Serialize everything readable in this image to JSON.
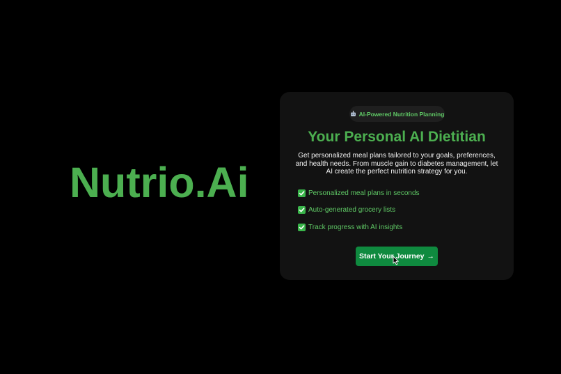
{
  "brand": {
    "name": "Nutrio.Ai",
    "color": "#4caf50"
  },
  "card": {
    "badge": {
      "icon": "robot-icon",
      "label": "AI-Powered Nutrition Planning"
    },
    "title": "Your Personal AI Dietitian",
    "description": "Get personalized meal plans tailored to your goals, preferences, and health needs. From muscle gain to diabetes management, let AI create the perfect nutrition strategy for you.",
    "features": [
      {
        "icon": "check-mark-icon",
        "label": "Personalized meal plans in seconds"
      },
      {
        "icon": "check-mark-icon",
        "label": "Auto-generated grocery lists"
      },
      {
        "icon": "check-mark-icon",
        "label": "Track progress with AI insights"
      }
    ],
    "cta": {
      "label": "Start Your Journey",
      "arrow": "→"
    }
  },
  "colors": {
    "background": "#000000",
    "card": "#121212",
    "accent": "#4caf50",
    "button": "#0f8a3f"
  }
}
